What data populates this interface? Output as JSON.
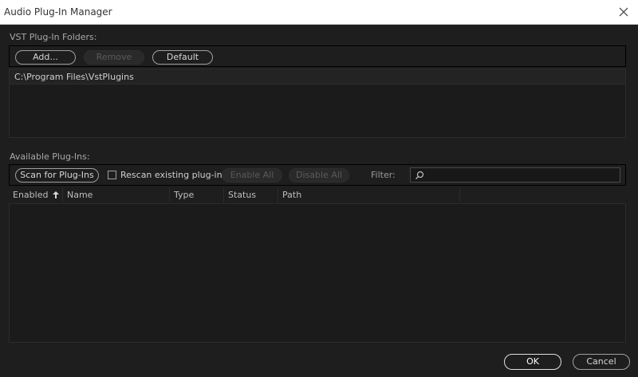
{
  "window": {
    "title": "Audio Plug-In Manager"
  },
  "vst_folders": {
    "label": "VST Plug-In Folders:",
    "buttons": {
      "add": "Add...",
      "remove": "Remove",
      "default": "Default"
    },
    "folders": [
      "C:\\Program Files\\VstPlugins"
    ]
  },
  "plugins": {
    "label": "Available Plug-Ins:",
    "scan_label": "Scan for Plug-Ins",
    "rescan_label": "Rescan existing plug-ins",
    "rescan_checked": false,
    "enable_all": "Enable All",
    "disable_all": "Disable All",
    "filter_label": "Filter:",
    "filter_value": "",
    "columns": [
      "Enabled",
      "Name",
      "Type",
      "Status",
      "Path"
    ],
    "sort_column": "Enabled",
    "rows": []
  },
  "footer": {
    "ok": "OK",
    "cancel": "Cancel"
  },
  "colors": {
    "background": "#1e1e1e",
    "titlebar": "#ffffff",
    "text": "#bdbdbd",
    "disabled_text": "#5a5a5a"
  }
}
